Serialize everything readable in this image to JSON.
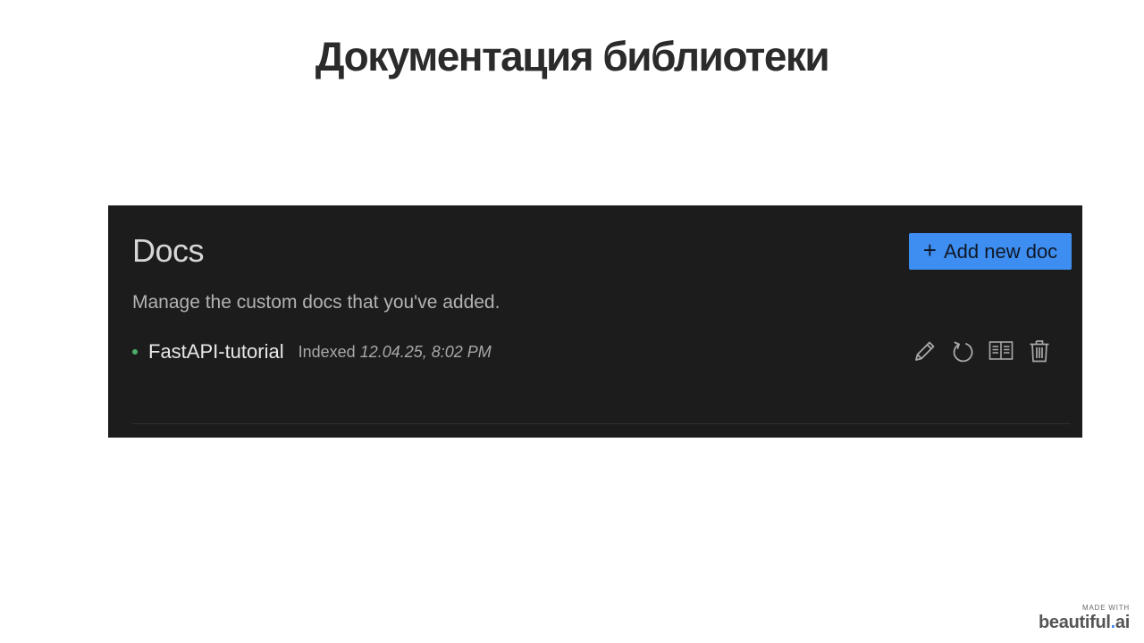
{
  "slide": {
    "title": "Документация библиотеки"
  },
  "docs_panel": {
    "heading": "Docs",
    "add_button": {
      "plus": "+",
      "label": "Add new doc"
    },
    "description": "Manage the custom docs that you've added.",
    "doc": {
      "name": "FastAPI-tutorial",
      "indexed_label": "Indexed",
      "indexed_date": "12.04.25, 8:02 PM",
      "status_color": "#4caf6a"
    },
    "actions": [
      {
        "icon": "pencil-icon"
      },
      {
        "icon": "refresh-icon"
      },
      {
        "icon": "book-icon"
      },
      {
        "icon": "trash-icon"
      }
    ]
  },
  "watermark": {
    "made_with": "MADE WITH",
    "brand_main": "beautiful",
    "brand_dot": ".",
    "brand_suffix": "ai"
  },
  "colors": {
    "panel_bg": "#1c1c1c",
    "accent": "#3d8ef0"
  }
}
